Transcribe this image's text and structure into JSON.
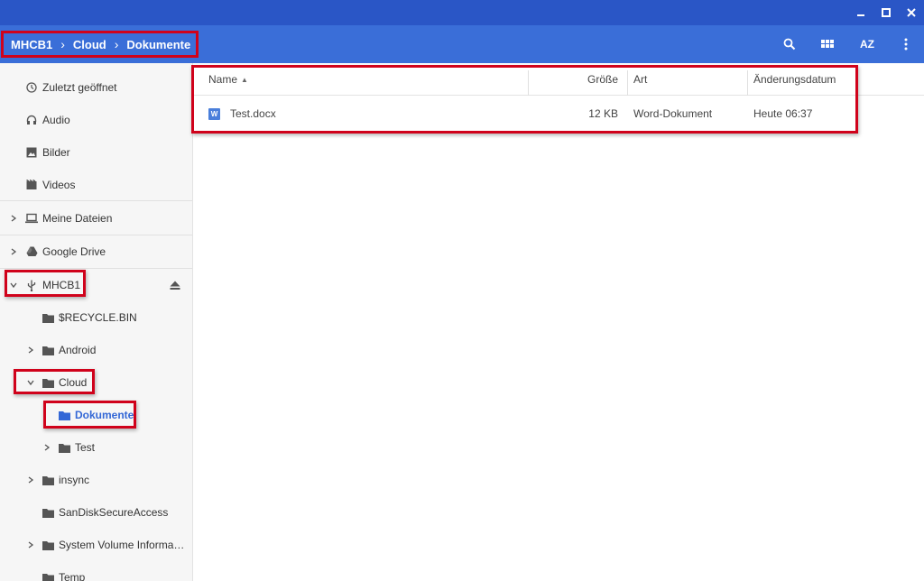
{
  "colors": {
    "titlebar": "#2a56c6",
    "header": "#3a6ed8",
    "selected": "#3367d6",
    "highlight": "#d0021b"
  },
  "breadcrumb": [
    "MHCB1",
    "Cloud",
    "Dokumente"
  ],
  "toolbar": {
    "search_icon": "search-icon",
    "grid_icon": "grid-view-icon",
    "sort_label": "AZ",
    "more_icon": "more-vert-icon"
  },
  "sidebar": {
    "recent": "Zuletzt geöffnet",
    "audio": "Audio",
    "images": "Bilder",
    "videos": "Videos",
    "my_files": "Meine Dateien",
    "google_drive": "Google Drive",
    "usb": "MHCB1",
    "tree": {
      "recycle": "$RECYCLE.BIN",
      "android": "Android",
      "cloud": "Cloud",
      "dokumente": "Dokumente",
      "test": "Test",
      "insync": "insync",
      "sandisk": "SanDiskSecureAccess",
      "sysvol": "System Volume Informati…",
      "temp": "Temp"
    }
  },
  "columns": {
    "name": "Name",
    "size": "Größe",
    "type": "Art",
    "modified": "Änderungsdatum"
  },
  "files": [
    {
      "icon_letter": "W",
      "name": "Test.docx",
      "size": "12 KB",
      "type": "Word-Dokument",
      "modified": "Heute 06:37"
    }
  ]
}
